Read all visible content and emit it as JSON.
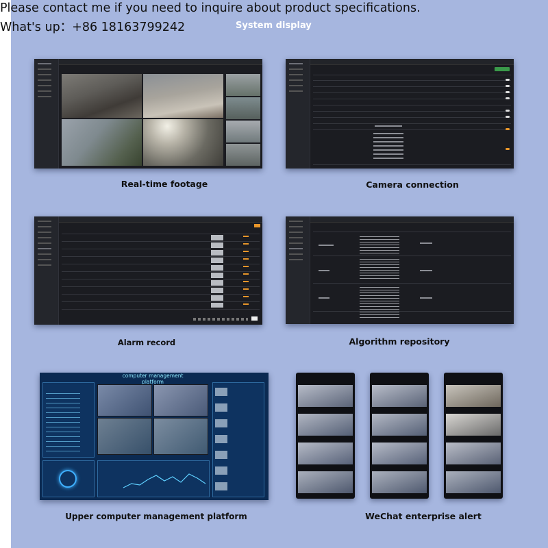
{
  "header": {
    "contact_line1": "Please contact me if you need to inquire about product specifications.",
    "contact_line2": "What's up：+86 18163799242",
    "section_title": "System display"
  },
  "panels": [
    {
      "id": "realtime",
      "caption": "Real-time footage"
    },
    {
      "id": "camera",
      "caption": "Camera connection"
    },
    {
      "id": "alarm",
      "caption": "Alarm record"
    },
    {
      "id": "algorithm",
      "caption": "Algorithm repository"
    },
    {
      "id": "upper",
      "caption": "Upper computer management platform",
      "screen_title": "computer management platform"
    },
    {
      "id": "wechat",
      "caption": "WeChat enterprise alert"
    }
  ],
  "colors": {
    "background": "#a6b6df",
    "screen_dark": "#1b1c21",
    "accent_green": "#3a9a4a",
    "accent_orange": "#e8962a",
    "platform_blue": "#0b2a52"
  }
}
